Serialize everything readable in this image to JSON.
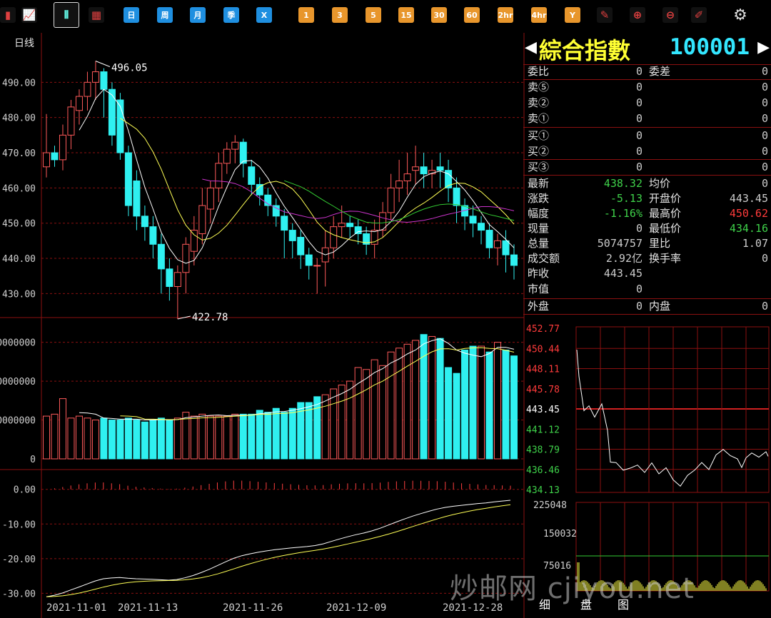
{
  "toolbar": {
    "buttons": [
      {
        "type": "icon",
        "glyph": "▮",
        "name": "menu-icon"
      },
      {
        "type": "icon",
        "glyph": "📈",
        "name": "line-chart-icon"
      },
      {
        "type": "sel",
        "glyph": "⫴",
        "name": "candlestick-icon"
      },
      {
        "type": "icon",
        "glyph": "▦",
        "name": "calendar-icon"
      },
      {
        "type": "blue",
        "label": "日"
      },
      {
        "type": "blue",
        "label": "周"
      },
      {
        "type": "blue",
        "label": "月"
      },
      {
        "type": "blue",
        "label": "季"
      },
      {
        "type": "blue",
        "label": "X"
      },
      {
        "type": "orange",
        "label": "1"
      },
      {
        "type": "orange",
        "label": "3"
      },
      {
        "type": "orange",
        "label": "5"
      },
      {
        "type": "orange",
        "label": "15"
      },
      {
        "type": "orange",
        "label": "30"
      },
      {
        "type": "orange",
        "label": "60"
      },
      {
        "type": "orange",
        "label": "2hr"
      },
      {
        "type": "orange",
        "label": "4hr"
      },
      {
        "type": "orange",
        "label": "Y"
      },
      {
        "type": "icon",
        "glyph": "✎",
        "name": "edit-icon"
      },
      {
        "type": "icon",
        "glyph": "⊕",
        "name": "zoom-in-icon"
      },
      {
        "type": "icon",
        "glyph": "⊖",
        "name": "zoom-out-icon"
      },
      {
        "type": "icon",
        "glyph": "✐",
        "name": "draw-icon"
      },
      {
        "type": "icon",
        "glyph": "⚙",
        "name": "gear-icon"
      }
    ]
  },
  "quote": {
    "index_name": "綜合指數",
    "index_code": "100001",
    "rows": [
      {
        "l": "委比",
        "v": "0",
        "l2": "委差",
        "v2": "0",
        "v2c": "#ccc"
      },
      {
        "l": "卖⑤",
        "v": "0",
        "l2": "",
        "v2": "0",
        "v2c": "#ccc"
      },
      {
        "l": "卖②",
        "v": "0",
        "l2": "",
        "v2": "0",
        "v2c": "#ccc"
      },
      {
        "l": "卖①",
        "v": "0",
        "l2": "",
        "v2": "0",
        "v2c": "#ccc"
      },
      {
        "l": "买①",
        "v": "0",
        "l2": "",
        "v2": "0",
        "v2c": "#ccc"
      },
      {
        "l": "买②",
        "v": "0",
        "l2": "",
        "v2": "0",
        "v2c": "#ccc"
      },
      {
        "l": "买③",
        "v": "0",
        "l2": "",
        "v2": "0",
        "v2c": "#ccc"
      },
      {
        "l": "最新",
        "v": "438.32",
        "vc": "#3fd24a",
        "l2": "均价",
        "v2": "0",
        "v2c": "#ccc"
      },
      {
        "l": "涨跌",
        "v": "-5.13",
        "vc": "#3fd24a",
        "l2": "开盘价",
        "v2": "443.45",
        "v2c": "#ccc"
      },
      {
        "l": "幅度",
        "v": "-1.16%",
        "vc": "#3fd24a",
        "l2": "最高价",
        "v2": "450.62",
        "v2c": "#ff3b3b"
      },
      {
        "l": "现量",
        "v": "0",
        "l2": "最低价",
        "v2": "434.16",
        "v2c": "#3fd24a"
      },
      {
        "l": "总量",
        "v": "5074757",
        "l2": "里比",
        "v2": "1.07",
        "v2c": "#ccc"
      },
      {
        "l": "成交额",
        "v": "2.92亿",
        "l2": "换手率",
        "v2": "0",
        "v2c": "#ccc"
      },
      {
        "l": "昨收",
        "v": "443.45",
        "l2": "",
        "v2": ""
      },
      {
        "l": "市值",
        "v": "0",
        "l2": "",
        "v2": ""
      },
      {
        "l": "外盘",
        "v": "0",
        "l2": "内盘",
        "v2": "0",
        "v2c": "#ccc"
      }
    ]
  },
  "chart_data": [
    {
      "type": "candlestick",
      "period_label": "日线",
      "y_ticks": [
        "490.00",
        "480.00",
        "470.00",
        "460.00",
        "450.00",
        "440.00",
        "430.00"
      ],
      "ylim": [
        424,
        500
      ],
      "high_label": "496.05",
      "low_label": "422.78",
      "x_labels": [
        "2021-11-01",
        "2021-11-13",
        "2021-11-26",
        "2021-12-09",
        "2021-12-28"
      ],
      "ohlc": [
        [
          466,
          470,
          463,
          481
        ],
        [
          470,
          468,
          466,
          472
        ],
        [
          468,
          475,
          465,
          478
        ],
        [
          475,
          483,
          471,
          485
        ],
        [
          482,
          486,
          478,
          488
        ],
        [
          486,
          490,
          482,
          493
        ],
        [
          490,
          493,
          485,
          496.05
        ],
        [
          493,
          488,
          480,
          494
        ],
        [
          488,
          475,
          472,
          490
        ],
        [
          485,
          470,
          468,
          487
        ],
        [
          470,
          455,
          452,
          472
        ],
        [
          462,
          452,
          448,
          465
        ],
        [
          452,
          449,
          445,
          455
        ],
        [
          449,
          444,
          440,
          452
        ],
        [
          444,
          437,
          430,
          447
        ],
        [
          437,
          432,
          428,
          440
        ],
        [
          432,
          436,
          422.78,
          438
        ],
        [
          436,
          444,
          430,
          446
        ],
        [
          442,
          448,
          438,
          452
        ],
        [
          447,
          455,
          444,
          460
        ],
        [
          454,
          460,
          450,
          462
        ],
        [
          460,
          467,
          456,
          470
        ],
        [
          467,
          471,
          464,
          473
        ],
        [
          471,
          473,
          467,
          475
        ],
        [
          473,
          467,
          463,
          474
        ],
        [
          466,
          461,
          458,
          468
        ],
        [
          461,
          458,
          455,
          463
        ],
        [
          458,
          455,
          452,
          460
        ],
        [
          455,
          452,
          449,
          457
        ],
        [
          452,
          448,
          440,
          454
        ],
        [
          448,
          445,
          440,
          450
        ],
        [
          446,
          441,
          437,
          448
        ],
        [
          441,
          438,
          434,
          443
        ],
        [
          438,
          438,
          430,
          440
        ],
        [
          439,
          443,
          432,
          448
        ],
        [
          443,
          449,
          440,
          452
        ],
        [
          449,
          450,
          446,
          455
        ],
        [
          450,
          449,
          446,
          452
        ],
        [
          449,
          447,
          444,
          451
        ],
        [
          447,
          444,
          441,
          449
        ],
        [
          444,
          448,
          440,
          451
        ],
        [
          448,
          453,
          446,
          456
        ],
        [
          453,
          460,
          451,
          464
        ],
        [
          460,
          462,
          456,
          468
        ],
        [
          462,
          464,
          458,
          470
        ],
        [
          465,
          466,
          461,
          472
        ],
        [
          466,
          464,
          460,
          470
        ],
        [
          464,
          465,
          460,
          468
        ],
        [
          466,
          465,
          460,
          470
        ],
        [
          465,
          460,
          456,
          468
        ],
        [
          460,
          455,
          450,
          463
        ],
        [
          455,
          452,
          448,
          457
        ],
        [
          452,
          450,
          446,
          455
        ],
        [
          450,
          448,
          444,
          452
        ],
        [
          448,
          443,
          440,
          450
        ],
        [
          443,
          445,
          438,
          447
        ],
        [
          445,
          441,
          436,
          448
        ],
        [
          441,
          438,
          434,
          444
        ]
      ]
    },
    {
      "type": "bar",
      "name": "volume",
      "y_ticks": [
        "0000000",
        "0000000",
        "0000000",
        "0"
      ],
      "values": [
        22,
        23,
        31,
        21,
        22,
        21,
        20,
        21,
        20,
        20,
        21,
        20,
        19,
        20,
        21,
        20,
        21,
        24,
        22,
        23,
        22,
        22,
        22,
        23,
        23,
        23,
        25,
        24,
        26,
        24,
        26,
        29,
        29,
        32,
        33,
        36,
        38,
        40,
        47,
        46,
        51,
        48,
        55,
        57,
        59,
        61,
        64,
        63,
        62,
        47,
        44,
        56,
        58,
        58,
        55,
        60,
        56,
        53
      ],
      "up": [
        1,
        1,
        1,
        1,
        1,
        1,
        1,
        0,
        0,
        0,
        0,
        0,
        0,
        0,
        0,
        0,
        1,
        1,
        1,
        1,
        1,
        1,
        1,
        1,
        0,
        0,
        0,
        0,
        0,
        0,
        0,
        0,
        0,
        0,
        1,
        1,
        1,
        1,
        1,
        1,
        1,
        1,
        1,
        1,
        1,
        1,
        0,
        1,
        0,
        0,
        0,
        0,
        0,
        1,
        0,
        1,
        0,
        0
      ]
    },
    {
      "type": "line",
      "name": "macd",
      "y_ticks": [
        "0.00",
        "-10.00",
        "-20.00",
        "-30.00"
      ],
      "ylim": [
        -33,
        2
      ]
    },
    {
      "type": "line",
      "name": "intraday",
      "y_ticks": [
        "452.77",
        "450.44",
        "448.11",
        "445.78",
        "443.45",
        "441.12",
        "438.79",
        "436.46",
        "434.13"
      ],
      "y_colors": [
        "#ff3b3b",
        "#ff3b3b",
        "#ff3b3b",
        "#ff3b3b",
        "#ffffff",
        "#3fd24a",
        "#3fd24a",
        "#3fd24a",
        "#3fd24a"
      ],
      "vol_ticks": [
        "225048",
        "150032",
        "75016"
      ]
    }
  ],
  "watermark": "炒邮网 cjiyou.net",
  "bottom_tabs": [
    "细",
    "盘",
    "图"
  ]
}
